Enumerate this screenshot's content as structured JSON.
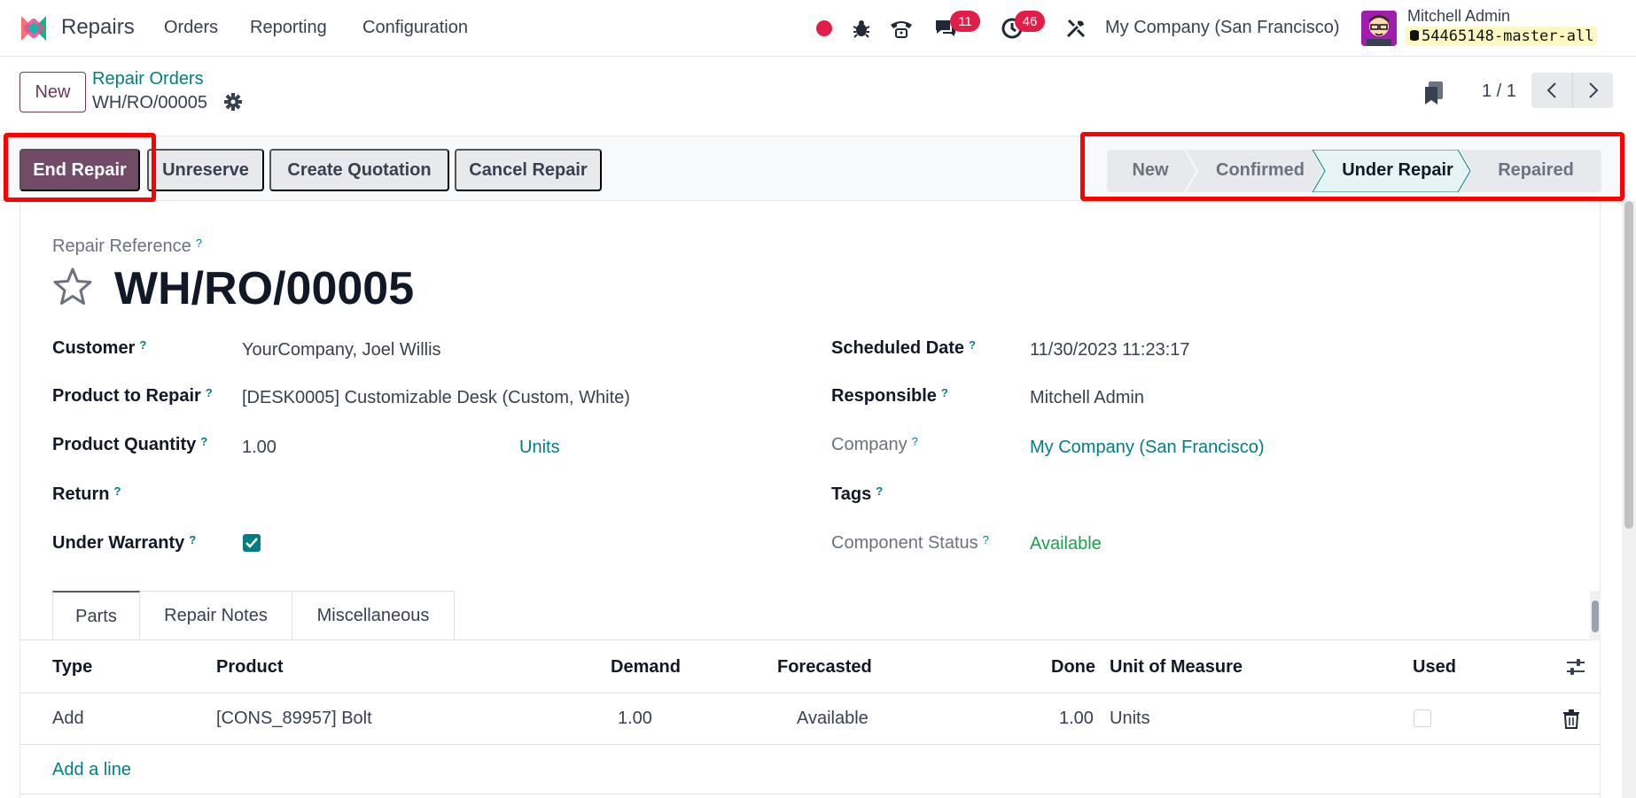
{
  "navbar": {
    "app_name": "Repairs",
    "menu": [
      "Orders",
      "Reporting",
      "Configuration"
    ],
    "chat_count": "11",
    "activity_count": "46",
    "company": "My Company (San Francisco)",
    "user_name": "Mitchell Admin",
    "db_name": "54465148-master-all"
  },
  "control": {
    "new_label": "New",
    "breadcrumb_parent": "Repair Orders",
    "breadcrumb_current": "WH/RO/00005",
    "pager": "1 / 1"
  },
  "actions": {
    "end_repair": "End Repair",
    "unreserve": "Unreserve",
    "create_quotation": "Create Quotation",
    "cancel_repair": "Cancel Repair"
  },
  "stages": [
    "New",
    "Confirmed",
    "Under Repair",
    "Repaired"
  ],
  "current_stage": "Under Repair",
  "form": {
    "ref_label": "Repair Reference",
    "ref_value": "WH/RO/00005",
    "help": "?",
    "customer_label": "Customer",
    "customer_value": "YourCompany, Joel Willis",
    "product_label": "Product to Repair",
    "product_value": "[DESK0005] Customizable Desk (Custom, White)",
    "qty_label": "Product Quantity",
    "qty_value": "1.00",
    "qty_uom": "Units",
    "return_label": "Return",
    "warranty_label": "Under Warranty",
    "warranty_checked": true,
    "scheduled_label": "Scheduled Date",
    "scheduled_value": "11/30/2023 11:23:17",
    "responsible_label": "Responsible",
    "responsible_value": "Mitchell Admin",
    "company_label": "Company",
    "company_value": "My Company (San Francisco)",
    "tags_label": "Tags",
    "component_label": "Component Status",
    "component_value": "Available"
  },
  "tabs": [
    "Parts",
    "Repair Notes",
    "Miscellaneous"
  ],
  "table": {
    "headers": [
      "Type",
      "Product",
      "Demand",
      "Forecasted",
      "Done",
      "Unit of Measure",
      "Used"
    ],
    "rows": [
      {
        "type": "Add",
        "product": "[CONS_89957] Bolt",
        "demand": "1.00",
        "forecasted": "Available",
        "done": "1.00",
        "uom": "Units",
        "used": false
      }
    ],
    "add_line": "Add a line"
  },
  "colors": {
    "brand": "#714b67",
    "link": "#017e84",
    "highlight": "#ff0000",
    "badge": "#e11d48",
    "available": "#16a34a"
  }
}
